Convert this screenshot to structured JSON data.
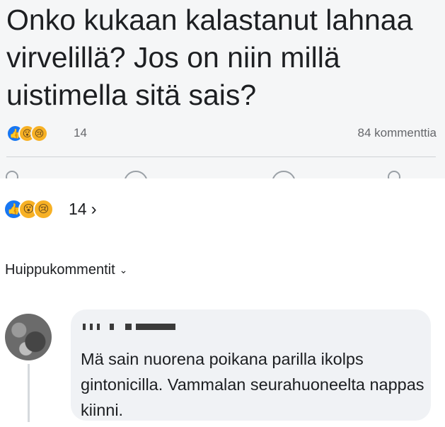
{
  "post": {
    "text": "Onko kukaan kalastanut lahnaa virvelillä? Jos on niin millä uistimella sitä sais?",
    "reaction_count": "14",
    "comment_count": "84 kommenttia"
  },
  "reactions": {
    "count": "14",
    "chevron": "›",
    "icons": [
      "like-icon",
      "wow-icon",
      "sad-icon"
    ]
  },
  "comments_section": {
    "filter_label": "Huippukommentit",
    "filter_caret": "⌄"
  },
  "comment": {
    "text": "Mä sain nuorena poikana parilla ikolps gintonicilla. Vammalan seurahuoneelta nappas kiinni."
  },
  "colors": {
    "like": "#1877f2",
    "reaction_yellow": "#f7b125",
    "bubble": "#f0f2f5",
    "muted_text": "#65676b"
  }
}
